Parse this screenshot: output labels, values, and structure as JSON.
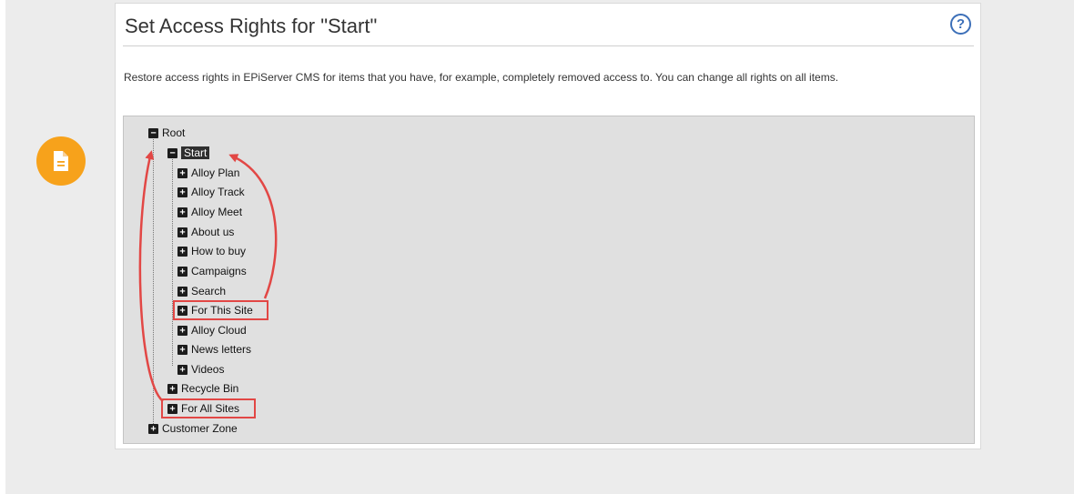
{
  "panel": {
    "title": "Set Access Rights for \"Start\"",
    "help_glyph": "?",
    "description": "Restore access rights in EPiServer CMS for items that you have, for example, completely removed access to. You can change all rights on all items."
  },
  "tree": {
    "root": "Root",
    "start": "Start",
    "start_children": [
      "Alloy Plan",
      "Alloy Track",
      "Alloy Meet",
      "About us",
      "How to buy",
      "Campaigns",
      "Search",
      "For This Site",
      "Alloy Cloud",
      "News letters",
      "Videos"
    ],
    "recycle_bin": "Recycle Bin",
    "for_all_sites": "For All Sites",
    "customer_zone": "Customer Zone",
    "expanded_glyph": "−",
    "collapsed_glyph": "+"
  },
  "icons": {
    "side_icon": "document-icon",
    "help": "help-icon"
  },
  "colors": {
    "accent_orange": "#f7a21b",
    "highlight_red": "#e24745",
    "help_blue": "#3c6fb8"
  }
}
